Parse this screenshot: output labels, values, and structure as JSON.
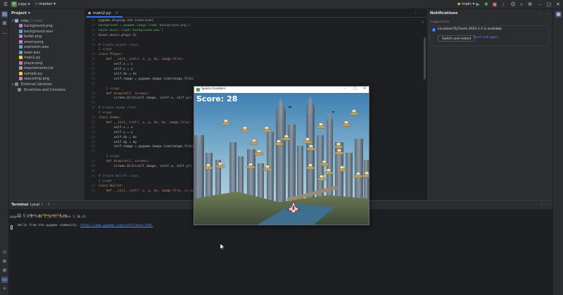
{
  "topbar": {
    "project_name": "mbe",
    "branch": "master",
    "run_config": "main"
  },
  "project_panel": {
    "header": "Project",
    "root": "mbe",
    "root_path": "C:\\mbe",
    "files": [
      {
        "name": "background.png",
        "color": "#c77dbb"
      },
      {
        "name": "background.wav",
        "color": "#58a6d6"
      },
      {
        "name": "bullet.png",
        "color": "#c77dbb"
      },
      {
        "name": "enemy.png",
        "color": "#c77dbb"
      },
      {
        "name": "explosion.wav",
        "color": "#58a6d6"
      },
      {
        "name": "laser.wav",
        "color": "#58a6d6"
      },
      {
        "name": "main2.py",
        "color": "#f0c44a"
      },
      {
        "name": "player.png",
        "color": "#c77dbb"
      },
      {
        "name": "requirements.txt",
        "color": "#9aa0a6"
      },
      {
        "name": "sample.py",
        "color": "#f0c44a"
      },
      {
        "name": "spaceship.png",
        "color": "#c77dbb"
      }
    ],
    "external": "External Libraries",
    "scratches": "Scratches and Consoles"
  },
  "editor": {
    "tab": "main2.py",
    "lines": [
      {
        "n": "13",
        "t": "pygame.display.set_icon(icon)"
      },
      {
        "n": "14",
        "t": "background = pygame.image.load('background.png')"
      },
      {
        "n": "15",
        "t": "mixer.music.load('background.wav')"
      },
      {
        "n": "16",
        "t": "mixer.music.play(-1)"
      },
      {
        "n": "17",
        "t": ""
      },
      {
        "n": "18",
        "t": "# Create player class"
      },
      {
        "n": "",
        "t": "1 usage"
      },
      {
        "n": "19",
        "t": "class Player:"
      },
      {
        "n": "20",
        "t": "    def __init__(self, x, y, dx, image_file):"
      },
      {
        "n": "21",
        "t": "        self.x = x"
      },
      {
        "n": "22",
        "t": "        self.y = y"
      },
      {
        "n": "23",
        "t": "        self.dx = dx"
      },
      {
        "n": "24",
        "t": "        self.image = pygame.image.load(image_file)"
      },
      {
        "n": "25",
        "t": ""
      },
      {
        "n": "",
        "t": "    1 usage"
      },
      {
        "n": "26",
        "t": "    def draw(self, screen):"
      },
      {
        "n": "27",
        "t": "        screen.blit(self.image, (self.x, self.y))"
      },
      {
        "n": "28",
        "t": ""
      },
      {
        "n": "29",
        "t": "# Create enemy class"
      },
      {
        "n": "",
        "t": "1 usage"
      },
      {
        "n": "30",
        "t": "class Enemy:"
      },
      {
        "n": "31",
        "t": "    def __init__(self, x, y, dx, dy, image_file):"
      },
      {
        "n": "32",
        "t": "        self.x = x"
      },
      {
        "n": "33",
        "t": "        self.y = y"
      },
      {
        "n": "34",
        "t": "        self.dx = dx"
      },
      {
        "n": "35",
        "t": "        self.dy = dy"
      },
      {
        "n": "36",
        "t": "        self.image = pygame.image.load(image_file)"
      },
      {
        "n": "37",
        "t": ""
      },
      {
        "n": "",
        "t": "    1 usage"
      },
      {
        "n": "38",
        "t": "    def draw(self, screen):"
      },
      {
        "n": "39",
        "t": "        screen.blit(self.image, (self.x, self.y))"
      },
      {
        "n": "40",
        "t": ""
      },
      {
        "n": "41",
        "t": "# Create bullet class"
      },
      {
        "n": "",
        "t": "1 usage"
      },
      {
        "n": "42",
        "t": "class Bullet:"
      },
      {
        "n": "43",
        "t": "    def __init__(self, x, y, dx, image_file, is_active"
      }
    ]
  },
  "notifications": {
    "title": "Notifications",
    "section": "Suggestions",
    "message": "Localized PyCharm 2023.1.2 is available",
    "btn_primary": "Switch and restart",
    "btn_secondary": "Don't ask again"
  },
  "terminal": {
    "tab_label": "Terminal",
    "subtab": "Local",
    "prompt": "PS C:\\mbe>",
    "command": "python main2.py",
    "out1": "pygame 2.4.0 (SDL 2.26.4, Python 3.10.4)",
    "out2_prefix": "Hello from the pygame community. ",
    "out2_link": "https://www.pygame.org/contribute.html"
  },
  "game": {
    "window_title": "Space Invaders",
    "score_label": "Score: 28"
  },
  "colors": {
    "accent": "#3574f0",
    "sky_top": "#3e7fb3",
    "sky_bottom": "#c9dde2"
  }
}
